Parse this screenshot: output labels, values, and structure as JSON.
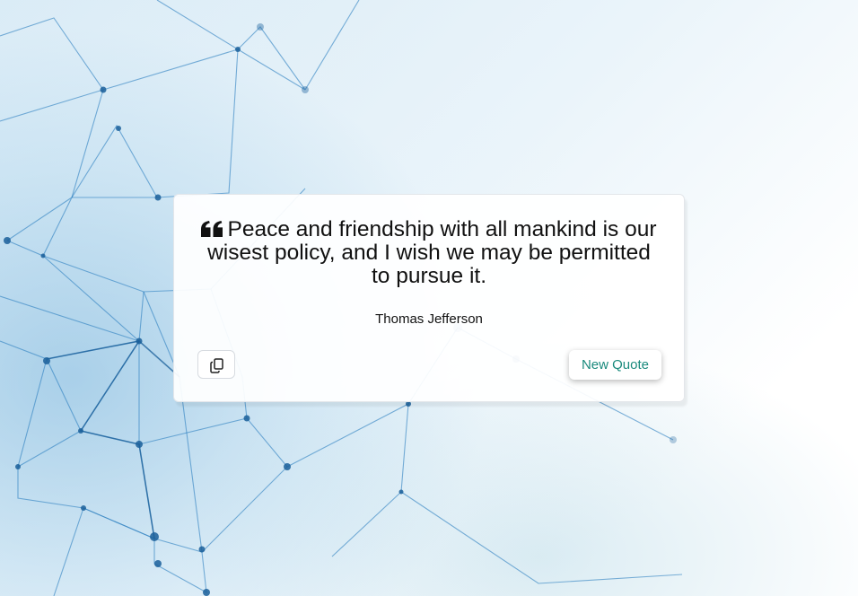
{
  "quote": {
    "text": "Peace and friendship with all mankind is our wisest policy, and I wish we may be permitted to pursue it.",
    "author": "Thomas Jefferson",
    "icon": "quote-left-icon"
  },
  "actions": {
    "copy_icon": "copy-icon",
    "new_quote_label": "New Quote"
  },
  "colors": {
    "accent": "#1a8a7d",
    "text": "#111111",
    "card_bg": "#ffffff",
    "network": "#1f6fb0"
  }
}
